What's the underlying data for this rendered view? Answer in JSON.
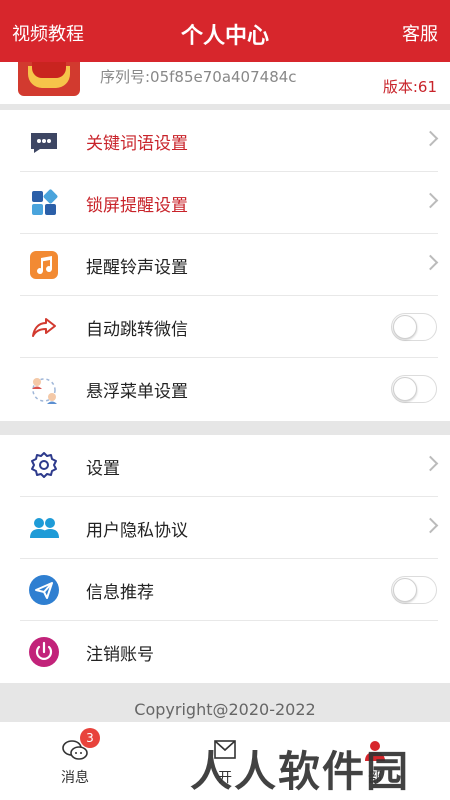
{
  "header": {
    "left_label": "视频教程",
    "title": "个人中心",
    "right_label": "客服"
  },
  "profile": {
    "serial": "序列号:05f85e70a407484c",
    "version": "版本:61"
  },
  "colors": {
    "brand": "#d7262c",
    "accent_text": "#c8232a"
  },
  "group1": [
    {
      "label": "关键词语设置",
      "icon": "chat-bubble-icon",
      "accessory": "chevron",
      "red": true
    },
    {
      "label": "锁屏提醒设置",
      "icon": "app-grid-icon",
      "accessory": "chevron",
      "red": true
    },
    {
      "label": "提醒铃声设置",
      "icon": "music-note-icon",
      "accessory": "chevron",
      "red": false
    },
    {
      "label": "自动跳转微信",
      "icon": "share-arrow-icon",
      "accessory": "toggle",
      "toggle_on": false,
      "red": false
    },
    {
      "label": "悬浮菜单设置",
      "icon": "floating-menu-icon",
      "accessory": "toggle",
      "toggle_on": false,
      "red": false
    }
  ],
  "group2": [
    {
      "label": "设置",
      "icon": "gear-icon",
      "accessory": "chevron"
    },
    {
      "label": "用户隐私协议",
      "icon": "users-icon",
      "accessory": "chevron"
    },
    {
      "label": "信息推荐",
      "icon": "paper-plane-icon",
      "accessory": "toggle",
      "toggle_on": false
    },
    {
      "label": "注销账号",
      "icon": "power-icon",
      "accessory": "none"
    }
  ],
  "footer": {
    "copyright": "Copyright@2020-2022"
  },
  "tabbar": {
    "tabs": [
      {
        "label": "消息",
        "icon": "chat-icon",
        "badge": "3"
      },
      {
        "label": "开",
        "icon": "mail-icon"
      },
      {
        "label": "部",
        "icon": "user-icon"
      }
    ]
  },
  "watermark": "人人软件园"
}
